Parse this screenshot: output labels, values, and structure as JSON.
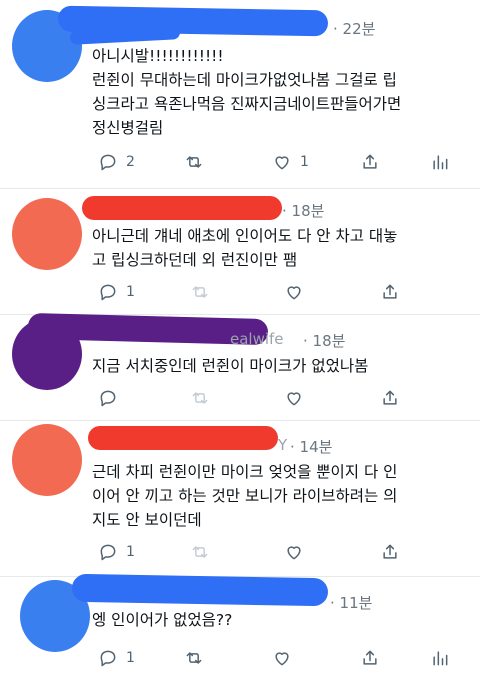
{
  "tweets": [
    {
      "time": "22분",
      "lines": [
        "아니시발!!!!!!!!!!!!",
        "런쥔이 무대하는데 마이크가없엇나봄 그걸로 립",
        "싱크라고 욕존나먹음 진짜지금네이트판들어가면",
        "정신병걸림"
      ],
      "replies": "2",
      "retweets": "",
      "likes": "1",
      "avatar_color": "#3a7ff0",
      "scribble_color": "#2f6ff5"
    },
    {
      "time": "18분",
      "lines": [
        "아니근데 걔네 애초에 인이어도 다 안 차고 대놓",
        "고 립싱크하던데 외 런진이만 팸"
      ],
      "replies": "1",
      "retweets": "",
      "likes": "",
      "avatar_color": "#f26a52",
      "scribble_color": "#f03a2e"
    },
    {
      "time": "18분",
      "handle_fragment": "ealwife",
      "lines": [
        "지금 서치중인데 런쥔이 마이크가 없었나봄"
      ],
      "replies": "",
      "retweets": "",
      "likes": "",
      "avatar_color": "#5a1f86",
      "scribble_color": "#5a1f86"
    },
    {
      "time": "14분",
      "handle_fragment": "Y",
      "lines": [
        "근데 차피 런쥔이만 마이크 엊엇을 뿐이지 다 인",
        "이어 안 끼고 하는 것만 보니가 라이브하려는 의",
        "지도 안 보이던데"
      ],
      "replies": "1",
      "retweets": "",
      "likes": "",
      "avatar_color": "#f26a52",
      "scribble_color": "#f03a2e"
    },
    {
      "time": "11분",
      "lines": [
        "엥 인이어가 없었음??"
      ],
      "replies": "1",
      "retweets": "",
      "likes": "",
      "avatar_color": "#3a7ff0",
      "scribble_color": "#2f6ff5"
    }
  ]
}
